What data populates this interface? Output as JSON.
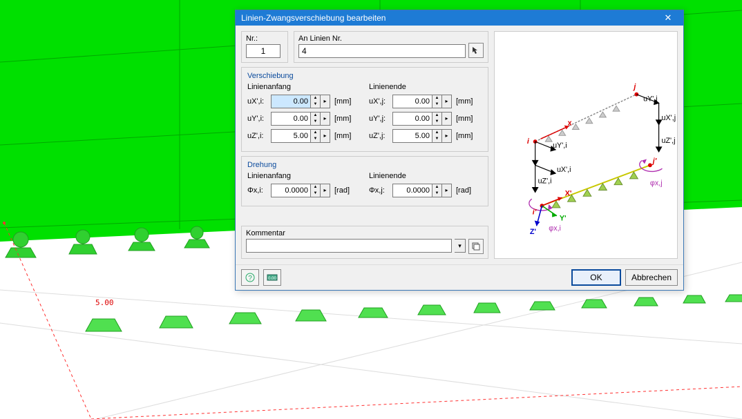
{
  "scene": {
    "annotation_value": "5.00"
  },
  "dialog": {
    "title": "Linien-Zwangsverschiebung bearbeiten",
    "nr_label": "Nr.:",
    "nr_value": "1",
    "lines_label": "An Linien Nr.",
    "lines_value": "4",
    "verschiebung": {
      "title": "Verschiebung",
      "start_label": "Linienanfang",
      "end_label": "Linienende",
      "unit": "[mm]",
      "rows": [
        {
          "li": "uX',i:",
          "vi": "0.00",
          "lj": "uX',j:",
          "vj": "0.00",
          "selected": true
        },
        {
          "li": "uY',i:",
          "vi": "0.00",
          "lj": "uY',j:",
          "vj": "0.00",
          "selected": false
        },
        {
          "li": "uZ',i:",
          "vi": "5.00",
          "lj": "uZ',j:",
          "vj": "5.00",
          "selected": false
        }
      ]
    },
    "drehung": {
      "title": "Drehung",
      "start_label": "Linienanfang",
      "end_label": "Linienende",
      "unit": "[rad]",
      "li": "Φx,i:",
      "vi": "0.0000",
      "lj": "Φx,j:",
      "vj": "0.0000"
    },
    "kommentar": {
      "title": "Kommentar",
      "value": ""
    },
    "buttons": {
      "ok": "OK",
      "cancel": "Abbrechen"
    }
  },
  "diagram": {
    "labels": {
      "i": "i",
      "j": "j",
      "ip": "i'",
      "jp": "j'",
      "xp": "X'",
      "yp": "Y'",
      "zp": "Z'",
      "x": "x",
      "uyi": "uY',i",
      "uxi": "uX',i",
      "uzi": "uZ',i",
      "uyj": "uY',j",
      "uxj": "uX',j",
      "uzj": "uZ',j",
      "phixi": "φx,i",
      "phixj": "φx,j"
    }
  }
}
